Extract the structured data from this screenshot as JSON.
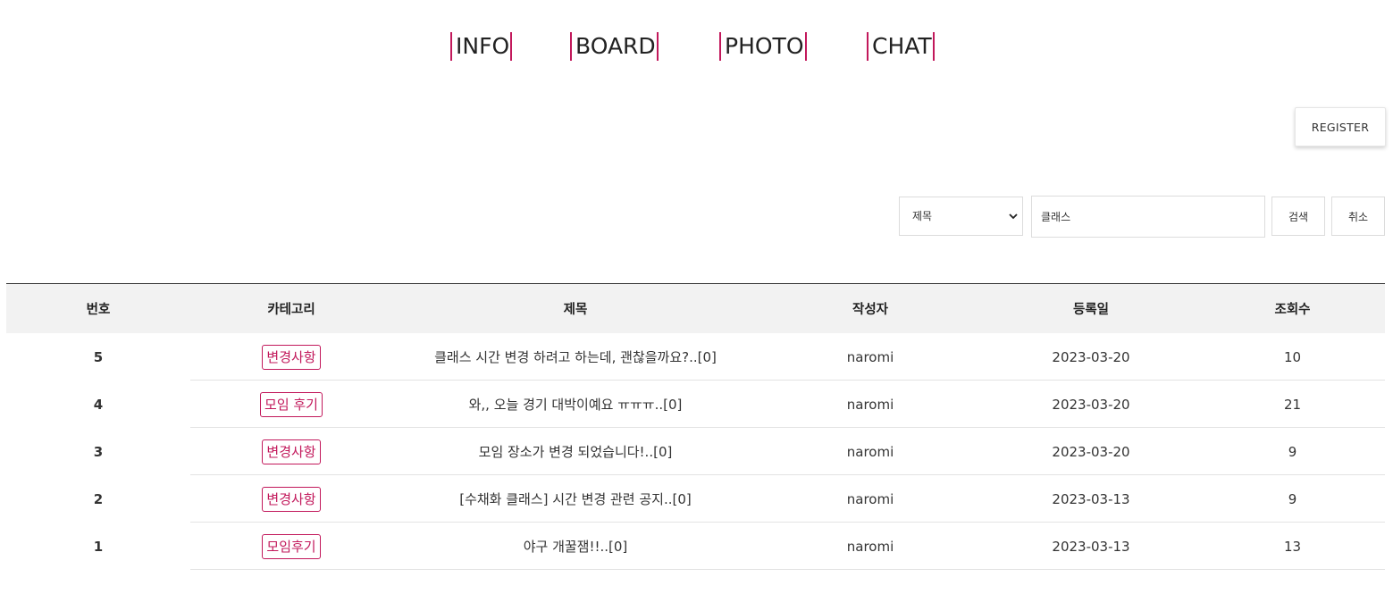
{
  "nav": {
    "items": [
      {
        "label": "INFO"
      },
      {
        "label": "BOARD"
      },
      {
        "label": "PHOTO"
      },
      {
        "label": "CHAT"
      }
    ]
  },
  "toolbar": {
    "register_label": "REGISTER"
  },
  "search": {
    "select_value": "제목",
    "query": "클래스",
    "search_label": "검색",
    "cancel_label": "취소"
  },
  "table": {
    "headers": [
      "번호",
      "카테고리",
      "제목",
      "작성자",
      "등록일",
      "조회수"
    ],
    "rows": [
      {
        "no": "5",
        "category": "변경사항",
        "title": "클래스 시간 변경 하려고 하는데, 괜찮을까요?..[0]",
        "author": "naromi",
        "date": "2023-03-20",
        "views": "10"
      },
      {
        "no": "4",
        "category": "모임 후기",
        "title": "와,, 오늘 경기 대박이예요 ㅠㅠㅠ..[0]",
        "author": "naromi",
        "date": "2023-03-20",
        "views": "21"
      },
      {
        "no": "3",
        "category": "변경사항",
        "title": "모임 장소가 변경 되었습니다!..[0]",
        "author": "naromi",
        "date": "2023-03-20",
        "views": "9"
      },
      {
        "no": "2",
        "category": "변경사항",
        "title": "[수채화 클래스] 시간 변경 관련 공지..[0]",
        "author": "naromi",
        "date": "2023-03-13",
        "views": "9"
      },
      {
        "no": "1",
        "category": "모임후기",
        "title": "야구 개꿀잼!!..[0]",
        "author": "naromi",
        "date": "2023-03-13",
        "views": "13"
      }
    ]
  },
  "colors": {
    "accent": "#c2185b",
    "header_bg": "#f2f2f2"
  }
}
